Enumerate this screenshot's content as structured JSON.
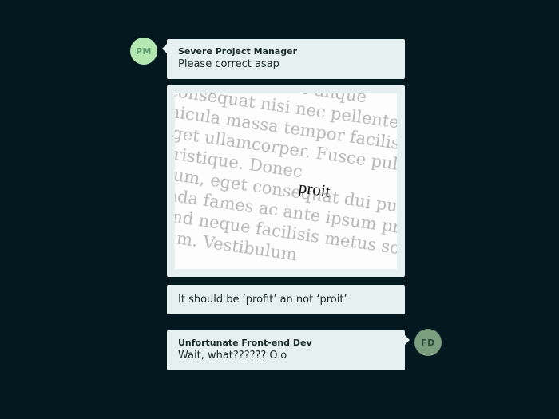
{
  "messages": [
    {
      "avatar": "PM",
      "sender": "Severe Project Manager",
      "text": "Please correct asap"
    },
    {
      "image_lines": [
        "gue vitae tellus ac alique",
        "n consequat nisi nec pellentesque",
        "vehicula massa tempor facilisis.",
        "a eget ullamcorper. Fusce pulvinar",
        "nt tristique. Donec",
        "ibulum, eget consequat dui pulvinar",
        "esuada fames ac ante ipsum primis",
        "leifend neque facilisis metus sodales",
        "rutrum. Vestibulum"
      ],
      "image_word": "proit"
    },
    {
      "text": "It should be ‘profit’ an not ‘proit’"
    },
    {
      "avatar": "FD",
      "sender": "Unfortunate Front-end Dev",
      "text": "Wait, what?????? O.o"
    }
  ],
  "colors": {
    "background": "#041820",
    "bubble": "#e6f0f0",
    "pm_avatar": "#b4e6b0",
    "fd_avatar": "#7a9e7e"
  }
}
